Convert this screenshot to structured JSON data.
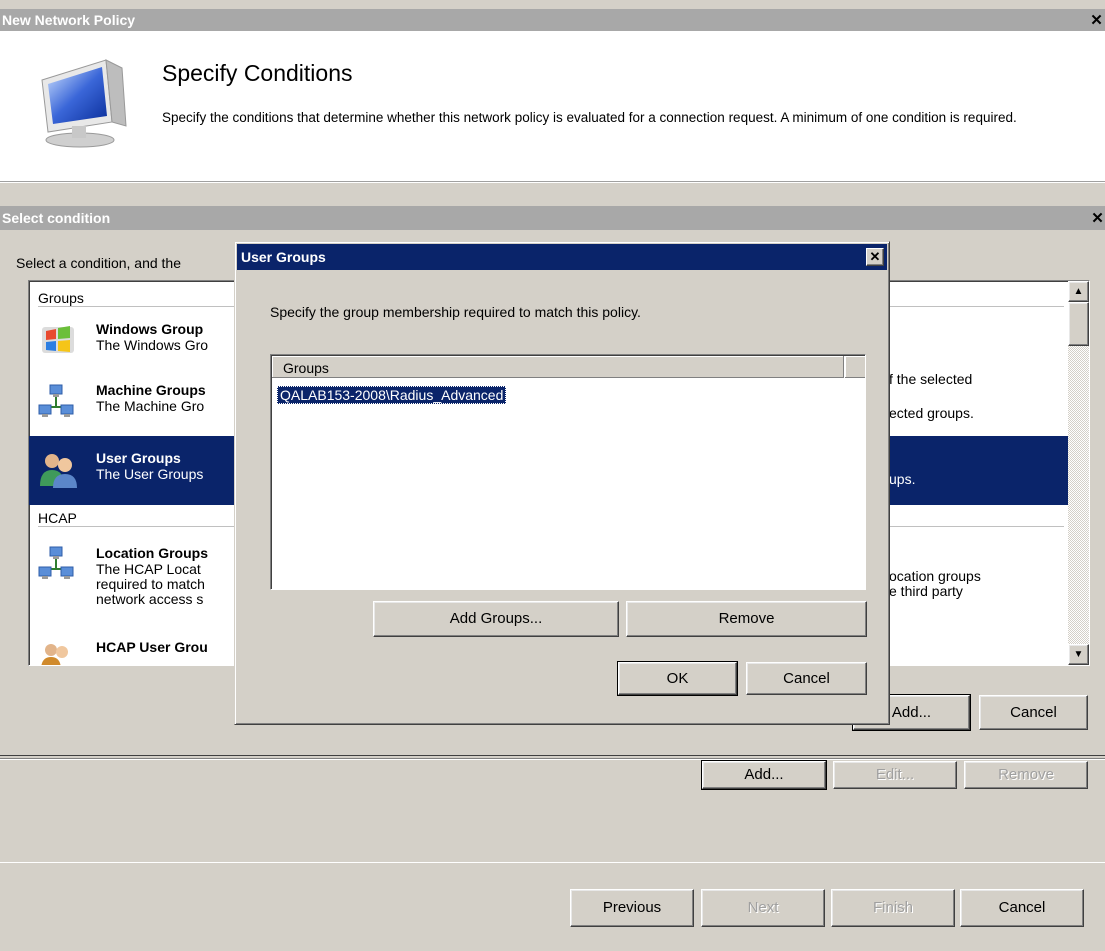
{
  "wizard": {
    "window_title": "New Network Policy",
    "close_glyph": "✕",
    "heading": "Specify Conditions",
    "description": "Specify the conditions that determine whether this network policy is evaluated for a connection request. A minimum of one condition is required.",
    "buttons": {
      "add": "Add...",
      "edit": "Edit...",
      "remove": "Remove"
    },
    "nav": {
      "previous": "Previous",
      "next": "Next",
      "finish": "Finish",
      "cancel": "Cancel"
    }
  },
  "select_condition": {
    "title": "Select condition",
    "close_glyph": "✕",
    "instruction": "Select a condition, and the",
    "groups": [
      {
        "label": "Groups",
        "items": [
          {
            "title": "Windows Group",
            "desc_lines": [
              "The Windows Gro"
            ],
            "right_text": "f the selected",
            "icon": "windows-groups-icon"
          },
          {
            "title": "Machine Groups",
            "desc_lines": [
              "The Machine Gro"
            ],
            "right_text": "ected groups.",
            "icon": "machine-groups-icon"
          },
          {
            "title": "User Groups",
            "desc_lines": [
              "The User Groups"
            ],
            "right_text": "ups.",
            "icon": "user-groups-icon",
            "selected": true
          }
        ]
      },
      {
        "label": "HCAP",
        "items": [
          {
            "title": "Location Groups",
            "desc_lines": [
              "The HCAP Locat",
              "required to match",
              "network access s"
            ],
            "right_lines": [
              "ocation groups",
              "e third party"
            ],
            "icon": "location-groups-icon"
          },
          {
            "title": "HCAP User Grou",
            "desc_lines": [],
            "icon": "hcap-user-groups-icon"
          }
        ]
      }
    ],
    "buttons": {
      "add": "Add...",
      "cancel": "Cancel"
    }
  },
  "user_groups_dialog": {
    "title": "User Groups",
    "close_glyph": "✕",
    "instruction": "Specify the group membership required to match this policy.",
    "list_header": "Groups",
    "list_items": [
      "QALAB153-2008\\Radius_Advanced"
    ],
    "buttons": {
      "add_groups": "Add Groups...",
      "remove": "Remove",
      "ok": "OK",
      "cancel": "Cancel"
    }
  },
  "colors": {
    "active_title": "#0a246a",
    "inactive_title": "#a8a8a8",
    "selection": "#0a246a",
    "face": "#d4d0c8"
  }
}
